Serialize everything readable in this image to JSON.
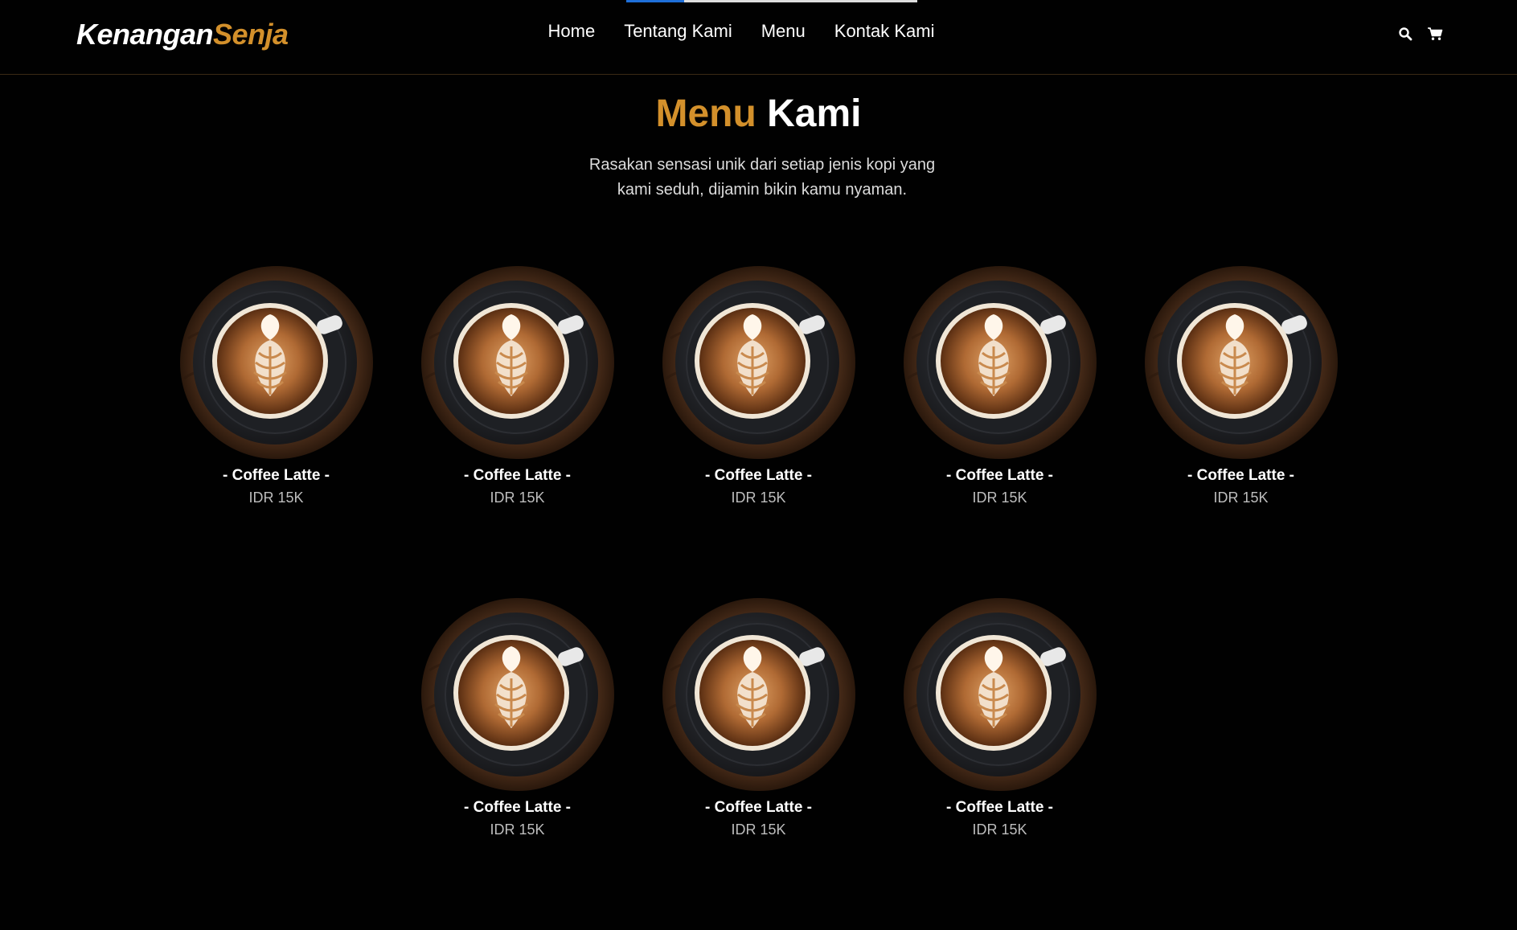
{
  "brand": {
    "name_part1": "Kenangan",
    "name_part2": "Senja"
  },
  "nav": {
    "links": [
      "Home",
      "Tentang Kami",
      "Menu",
      "Kontak Kami"
    ],
    "icons": [
      "search-icon",
      "cart-icon"
    ],
    "scroll_progress": 0.2
  },
  "menu": {
    "title_accent": "Menu",
    "title_rest": "Kami",
    "description": "Rasakan sensasi unik dari setiap jenis kopi yang kami seduh, dijamin bikin kamu nyaman.",
    "rows": [
      [
        {
          "name": "- Coffee Latte -",
          "price": "IDR 15K"
        },
        {
          "name": "- Coffee Latte -",
          "price": "IDR 15K"
        },
        {
          "name": "- Coffee Latte -",
          "price": "IDR 15K"
        },
        {
          "name": "- Coffee Latte -",
          "price": "IDR 15K"
        },
        {
          "name": "- Coffee Latte -",
          "price": "IDR 15K"
        }
      ],
      [
        {
          "name": "- Coffee Latte -",
          "price": "IDR 15K"
        },
        {
          "name": "- Coffee Latte -",
          "price": "IDR 15K"
        },
        {
          "name": "- Coffee Latte -",
          "price": "IDR 15K"
        }
      ]
    ]
  },
  "colors": {
    "accent": "#d3902b",
    "background": "#010101",
    "progress": "#1e6fd9"
  }
}
